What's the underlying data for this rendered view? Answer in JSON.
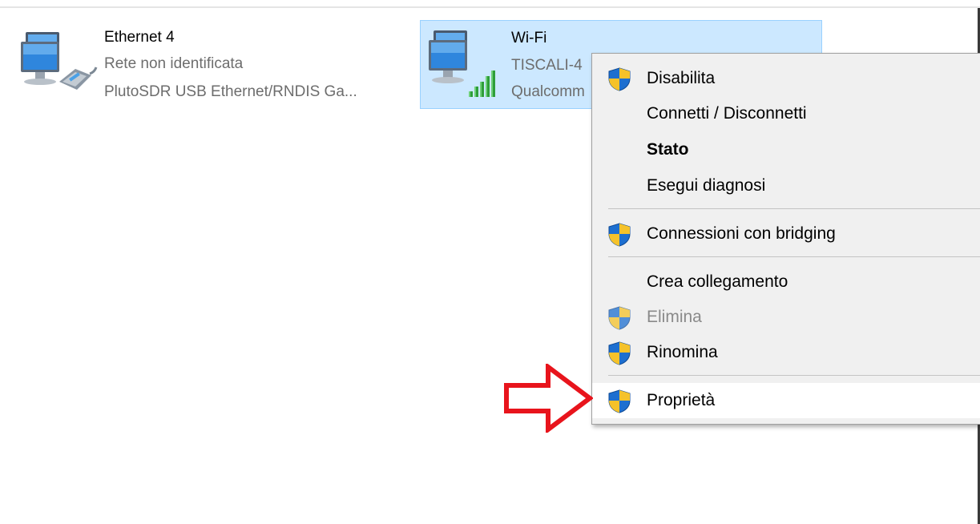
{
  "adapters": [
    {
      "name": "Ethernet 4",
      "status": "Rete non identificata",
      "device": "PlutoSDR USB Ethernet/RNDIS Ga...",
      "icon": "ethernet-adapter-icon",
      "selected": false
    },
    {
      "name": "Wi-Fi",
      "status": "TISCALI-4",
      "device": "Qualcomm",
      "icon": "wifi-adapter-icon",
      "selected": true
    }
  ],
  "context_menu": {
    "items": [
      {
        "label": "Disabilita",
        "shield": true
      },
      {
        "label": "Connetti / Disconnetti",
        "shield": false
      },
      {
        "label": "Stato",
        "shield": false,
        "default": true
      },
      {
        "label": "Esegui diagnosi",
        "shield": false
      },
      {
        "label": "Connessioni con bridging",
        "shield": true
      },
      {
        "label": "Crea collegamento",
        "shield": false
      },
      {
        "label": "Elimina",
        "shield": true,
        "disabled": true
      },
      {
        "label": "Rinomina",
        "shield": true
      },
      {
        "label": "Proprietà",
        "shield": true,
        "highlighted": true
      }
    ]
  },
  "annotation": {
    "icon": "red-arrow-icon",
    "color": "#e8141c"
  },
  "colors": {
    "selection_bg": "#cce8ff",
    "selection_border": "#99d1ff",
    "menu_bg": "#f0f0f0",
    "shield_blue": "#1d6fd0",
    "shield_yellow": "#f5c22a"
  }
}
